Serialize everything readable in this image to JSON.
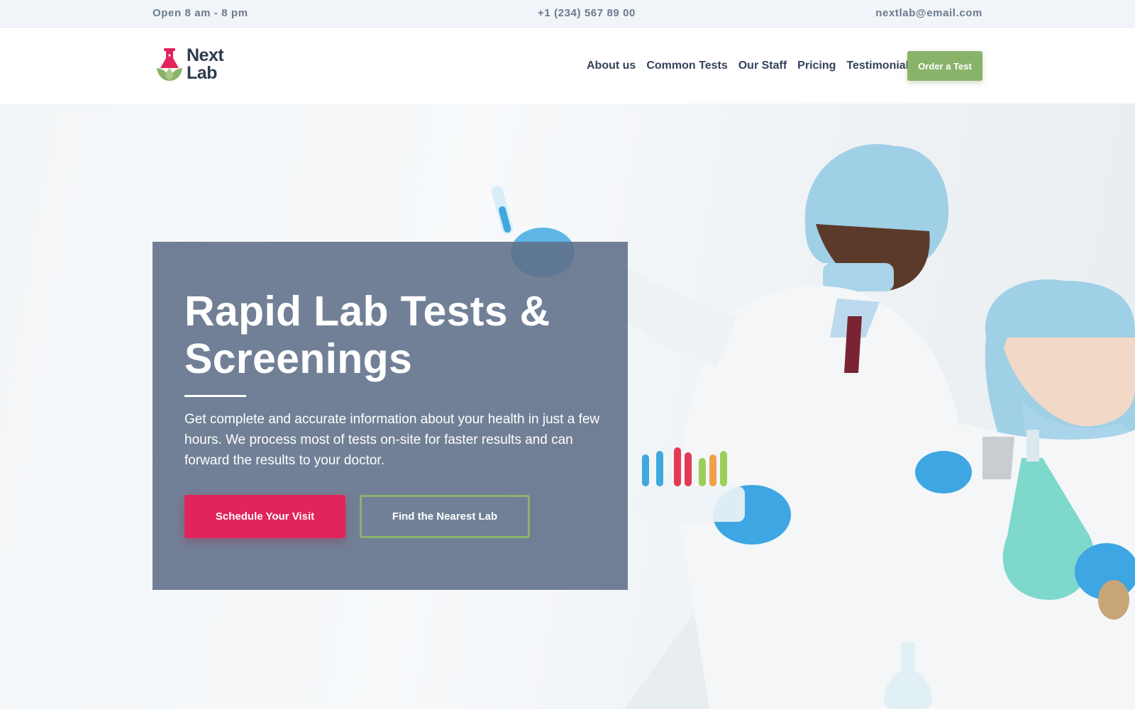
{
  "topbar": {
    "hours": "Open 8 am - 8 pm",
    "phone": "+1 (234) 567 89 00",
    "email": "nextlab@email.com"
  },
  "brand": {
    "line1": "Next",
    "line2": "Lab",
    "icon": "flask-leaf-logo-icon"
  },
  "nav": {
    "items": [
      "About us",
      "Common Tests",
      "Our Staff",
      "Pricing",
      "Testimonials"
    ],
    "cta": "Order a Test"
  },
  "hero": {
    "title": "Rapid Lab Tests & Screenings",
    "description": "Get complete and accurate information about your health in just a few hours. We process most of tests on-site for faster results and can forward the results to your doctor.",
    "primary_button": "Schedule Your Visit",
    "secondary_button": "Find the Nearest Lab"
  },
  "colors": {
    "accent_pink": "#e1245a",
    "accent_green": "#8ab36a",
    "card": "#5f6e87",
    "navy": "#2d3b4e"
  }
}
